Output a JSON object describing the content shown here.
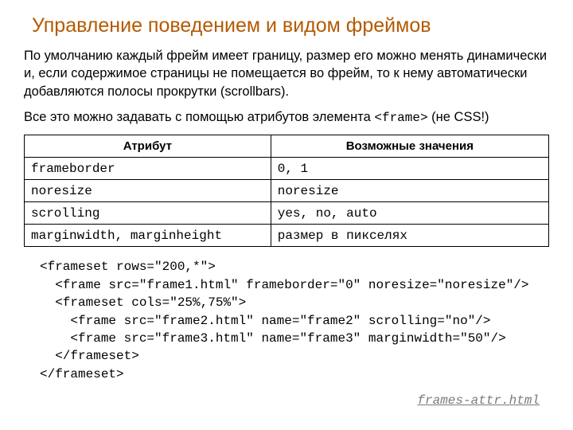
{
  "title": "Управление поведением и видом фреймов",
  "para1": "По умолчанию каждый фрейм имеет границу, размер его можно менять динамически и, если содержимое страницы не помещается во фрейм, то к нему автоматически добавляются полосы прокрутки (scrollbars).",
  "para2_a": "Все это можно задавать с помощью атрибутов элемента ",
  "para2_tag": "<frame>",
  "para2_b": " (не CSS!)",
  "table": {
    "head": {
      "attr": "Атрибут",
      "vals": "Возможные значения"
    },
    "rows": [
      {
        "attr": "frameborder",
        "vals": "0, 1"
      },
      {
        "attr": "noresize",
        "vals": "noresize"
      },
      {
        "attr": "scrolling",
        "vals": "yes, no, auto"
      },
      {
        "attr": "marginwidth, marginheight",
        "vals": "размер в пикселях"
      }
    ]
  },
  "code": "<frameset rows=\"200,*\">\n  <frame src=\"frame1.html\" frameborder=\"0\" noresize=\"noresize\"/>\n  <frameset cols=\"25%,75%\">\n    <frame src=\"frame2.html\" name=\"frame2\" scrolling=\"no\"/>\n    <frame src=\"frame3.html\" name=\"frame3\" marginwidth=\"50\"/>\n  </frameset>\n</frameset>",
  "link": "frames-attr.html"
}
